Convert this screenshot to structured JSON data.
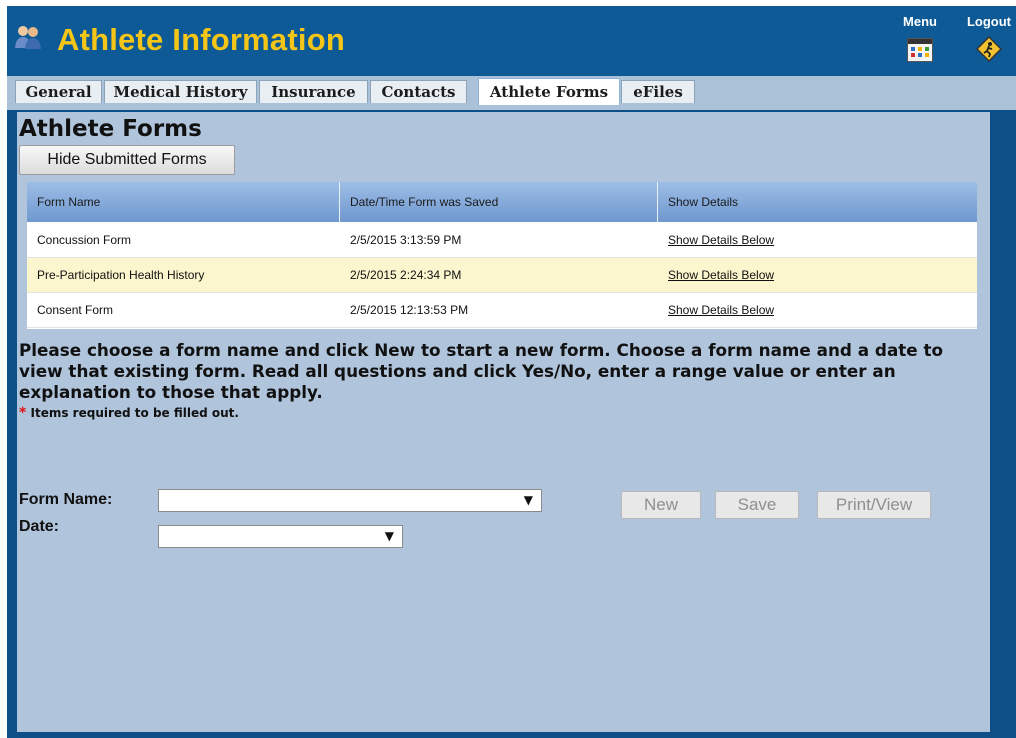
{
  "app": {
    "title": "Athlete Information",
    "menu_label": "Menu",
    "logout_label": "Logout"
  },
  "tabs": [
    {
      "label": "General"
    },
    {
      "label": "Medical History"
    },
    {
      "label": "Insurance"
    },
    {
      "label": "Contacts"
    },
    {
      "label": "Athlete Forms",
      "active": true
    },
    {
      "label": "eFiles"
    }
  ],
  "page": {
    "heading": "Athlete Forms",
    "hide_button": "Hide Submitted Forms"
  },
  "grid": {
    "columns": [
      "Form Name",
      "Date/Time Form was Saved",
      "Show Details"
    ],
    "rows": [
      {
        "name": "Concussion Form",
        "date": "2/5/2015 3:13:59 PM",
        "details": "Show Details Below"
      },
      {
        "name": "Pre-Participation Health History",
        "date": "2/5/2015 2:24:34 PM",
        "details": "Show Details Below"
      },
      {
        "name": "Consent Form",
        "date": "2/5/2015 12:13:53 PM",
        "details": "Show Details Below"
      }
    ]
  },
  "instructions": "Please choose a form name and click New to start a new form. Choose a form name and a date to view that existing form. Read all questions and click Yes/No, enter a range value or enter an explanation to those that apply.",
  "required_note": {
    "star": "*",
    "text": "Items required to be filled out."
  },
  "form": {
    "form_name_label": "Form Name:",
    "form_name_value": "",
    "date_label": "Date:",
    "date_value": "",
    "new_button": "New",
    "save_button": "Save",
    "print_button": "Print/View"
  },
  "colors": {
    "header": "#0e5a96",
    "title": "#f5c518",
    "content": "#b0c4dc",
    "highlight_row": "#fbf6cd"
  }
}
